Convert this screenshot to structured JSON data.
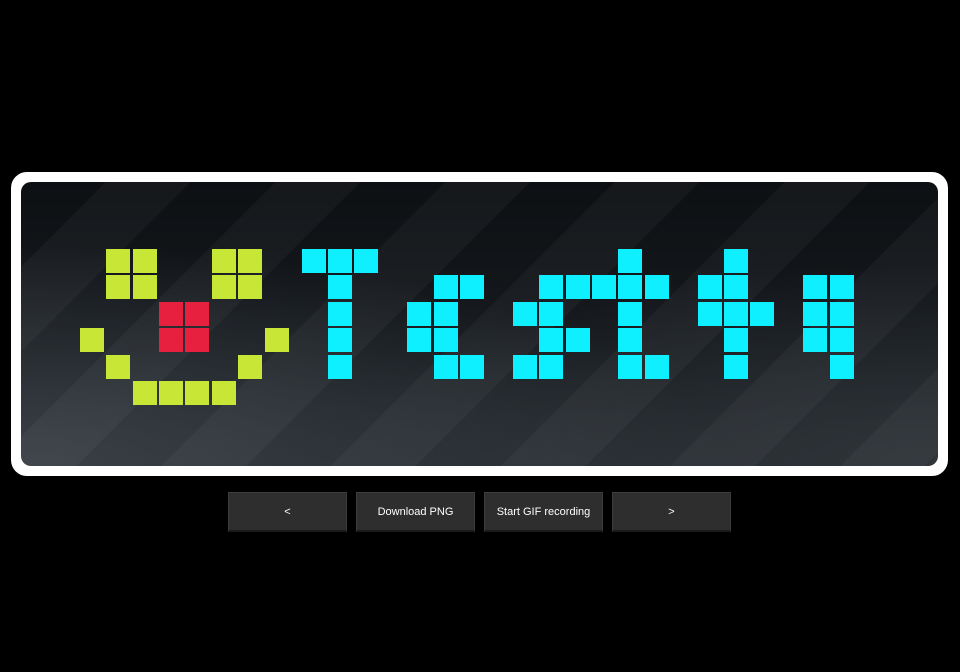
{
  "display": {
    "colors": {
      "face": "#c8e636",
      "nose": "#e8203f",
      "text": "#0ef0ff"
    },
    "icons": [
      "smiley-face-icon"
    ]
  },
  "controls": {
    "prev_label": "<",
    "download_png_label": "Download PNG",
    "gif_label": "Start GIF recording",
    "next_label": ">"
  }
}
